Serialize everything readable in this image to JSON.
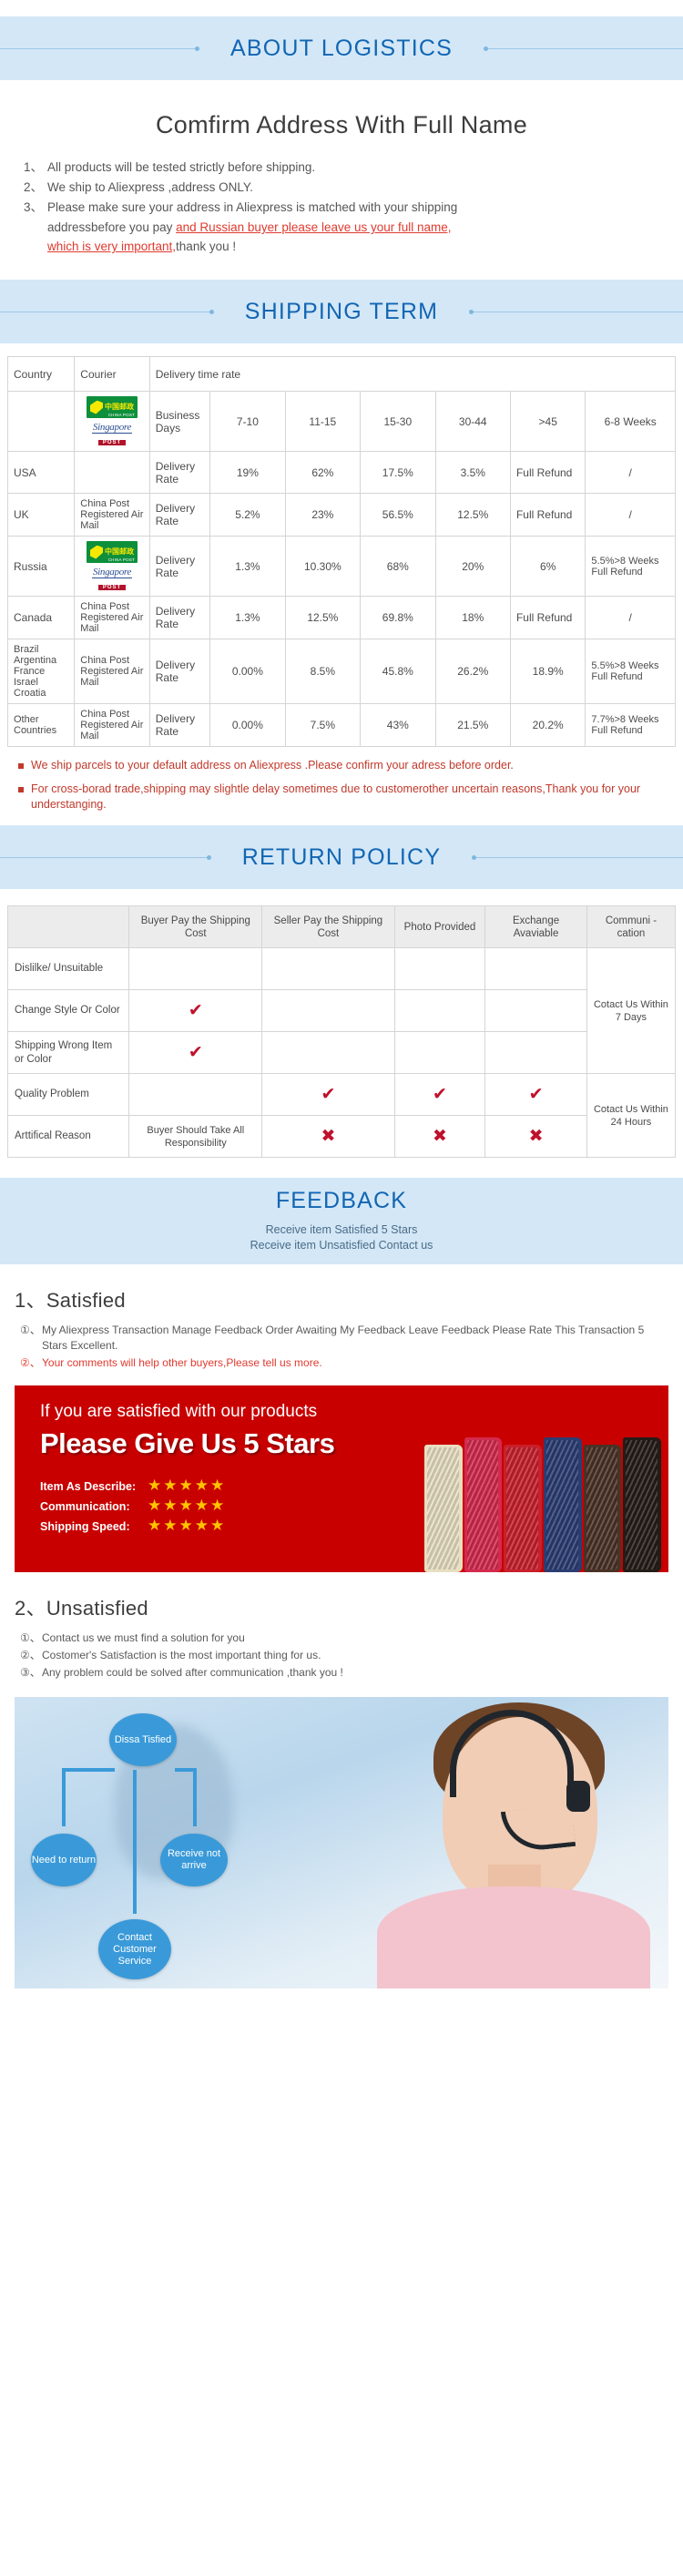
{
  "sections": {
    "about": {
      "banner": "ABOUT LOGISTICS"
    },
    "shipping": {
      "banner": "SHIPPING TERM"
    },
    "return": {
      "banner": "RETURN POLICY"
    },
    "feedback": {
      "banner": "FEEDBACK"
    }
  },
  "about": {
    "heading": "Comfirm  Address With Full Name",
    "items": [
      {
        "num": "1、",
        "text": "All products will be tested strictly before shipping."
      },
      {
        "num": "2、",
        "text": "We ship to Aliexpress ,address ONLY."
      },
      {
        "num": "3、",
        "text": "Please make sure your address in Aliexpress is matched with your shipping"
      }
    ],
    "line_a_plain": "addressbefore you pay ",
    "line_a_red": "and Russian buyer please leave us your full name,",
    "line_b_red": "which is very important,",
    "line_b_plain": "thank you !"
  },
  "shipping_table": {
    "head": {
      "country": "Country",
      "courier": "Courier",
      "delivery": "Delivery time rate"
    },
    "ranges": [
      "Business Days",
      "7-10",
      "11-15",
      "15-30",
      "30-44",
      ">45",
      "6-8 Weeks"
    ],
    "rows": [
      {
        "country": "USA",
        "courier": "",
        "courier_logo": "none",
        "rate_label": "Delivery Rate",
        "values": [
          "19%",
          "62%",
          "17.5%",
          "3.5%",
          "Full Refund",
          "/"
        ]
      },
      {
        "country": "UK",
        "courier": "China Post Registered Air Mail",
        "courier_logo": "none",
        "rate_label": "Delivery Rate",
        "values": [
          "5.2%",
          "23%",
          "56.5%",
          "12.5%",
          "Full Refund",
          "/"
        ]
      },
      {
        "country": "Russia",
        "courier": "",
        "courier_logo": "china-post-singapore-post",
        "rate_label": "Delivery Rate",
        "values": [
          "1.3%",
          "10.30%",
          "68%",
          "20%",
          "6%",
          "5.5%>8 Weeks Full Refund"
        ]
      },
      {
        "country": "Canada",
        "courier": "China Post Registered Air Mail",
        "courier_logo": "none",
        "rate_label": "Delivery Rate",
        "values": [
          "1.3%",
          "12.5%",
          "69.8%",
          "18%",
          "Full Refund",
          "/"
        ]
      },
      {
        "country": "Brazil Argentina France Israel Croatia",
        "courier": "China Post Registered Air Mail",
        "courier_logo": "none",
        "rate_label": "Delivery Rate",
        "values": [
          "0.00%",
          "8.5%",
          "45.8%",
          "26.2%",
          "18.9%",
          "5.5%>8 Weeks Full Refund"
        ]
      },
      {
        "country": "Other Countries",
        "courier": "China Post Registered Air Mail",
        "courier_logo": "none",
        "rate_label": "Delivery Rate",
        "values": [
          "0.00%",
          "7.5%",
          "43%",
          "21.5%",
          "20.2%",
          "7.7%>8 Weeks Full Refund"
        ]
      }
    ],
    "logo_labels": {
      "china_post_cn": "中国邮政",
      "china_post_en": "CHINA POST",
      "singapore": "Singapore",
      "singapore_post": "POST"
    }
  },
  "shipping_notes": [
    "We ship parcels to your default address on Aliexpress .Please confirm your adress before order.",
    "For cross-borad trade,shipping may slightle delay sometimes due to customerother uncertain reasons,Thank you for your understanging."
  ],
  "return_table": {
    "headers": [
      "",
      "Buyer Pay the Shipping Cost",
      "Seller Pay the Shipping Cost",
      "Photo Provided",
      "Exchange Avaviable",
      "Communi -cation"
    ],
    "rows": [
      {
        "label": "Dislilke/ Unsuitable",
        "cells": [
          "",
          "",
          "",
          ""
        ],
        "comm": ""
      },
      {
        "label": "Change Style Or Color",
        "cells": [
          "check",
          "",
          "",
          ""
        ],
        "comm": "Cotact  Us Within 7 Days"
      },
      {
        "label": "Shipping Wrong Item or Color",
        "cells": [
          "check",
          "",
          "",
          ""
        ],
        "comm": ""
      },
      {
        "label": "Quality Problem",
        "cells": [
          "",
          "check",
          "check",
          "check"
        ],
        "comm": "Cotact  Us Within 24 Hours"
      },
      {
        "label": "Arttifical Reason",
        "cells": [
          "Buyer Should Take All Responsibility",
          "cross",
          "cross",
          "cross"
        ],
        "comm": ""
      }
    ],
    "check_glyph": "✔",
    "cross_glyph": "✖"
  },
  "feedback": {
    "sub_line1": "Receive item Satisfied 5 Stars",
    "sub_line2": "Receive item Unsatisfied Contact us",
    "satisfied_head": "1、Satisfied",
    "satisfied_items": [
      {
        "n": "①、",
        "t": "My Aliexpress Transaction Manage Feedback Order Awaiting My Feedback Leave Feedback Please Rate This Transaction 5 Stars Excellent.",
        "red": false
      },
      {
        "n": "②、",
        "t": "Your comments will help other buyers,Please tell us more.",
        "red": true
      }
    ],
    "unsatisfied_head": "2、Unsatisfied",
    "unsatisfied_items": [
      {
        "n": "①、",
        "t": "Contact us we must find a solution for you"
      },
      {
        "n": "②、",
        "t": "Costomer's Satisfaction is the most important thing for us."
      },
      {
        "n": "③、",
        "t": "Any problem could be solved after communication ,thank you !"
      }
    ]
  },
  "promo": {
    "line1": "If you are satisfied with our products",
    "line2": "Please Give Us 5 Stars",
    "ratings": [
      {
        "label": "Item As Describe:",
        "stars": "★★★★★"
      },
      {
        "label": "Communication:",
        "stars": "★★★★★"
      },
      {
        "label": "Shipping Speed:",
        "stars": "★★★★★"
      }
    ],
    "wallet_colors": [
      "#e8dfc2",
      "#d32a4e",
      "#c8202c",
      "#2b3d72",
      "#4a3226",
      "#241c17"
    ]
  },
  "flow": {
    "bubbles": [
      {
        "id": "dissatisfied",
        "text": "Dissa Tisfied"
      },
      {
        "id": "need-to-return",
        "text": "Need to return"
      },
      {
        "id": "receive-not-arrive",
        "text": "Receive not arrive"
      },
      {
        "id": "contact-customer-service",
        "text": "Contact Customer Service"
      }
    ]
  },
  "colors": {
    "banner_bg": "#d3e7f7",
    "banner_text": "#1266b2",
    "accent_red": "#e03a2f",
    "promo_red": "#c80000",
    "star_yellow": "#ffc300",
    "check_red": "#c0102b"
  }
}
